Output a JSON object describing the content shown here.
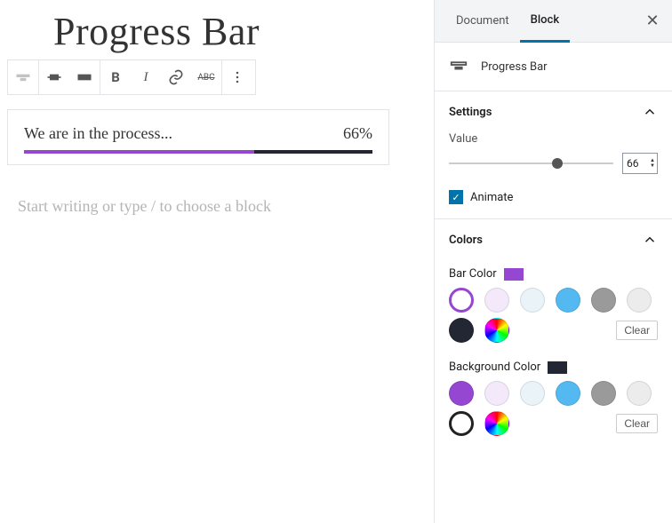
{
  "editor": {
    "page_title": "Progress Bar",
    "progress_label": "We are in the process...",
    "progress_value_text": "66%",
    "progress_percent": 66,
    "placeholder": "Start writing or type / to choose a block"
  },
  "sidebar": {
    "tabs": {
      "document": "Document",
      "block": "Block"
    },
    "block_name": "Progress Bar",
    "panels": {
      "settings": {
        "title": "Settings",
        "value_label": "Value",
        "value": "66",
        "animate_label": "Animate",
        "animate_checked": true
      },
      "colors": {
        "title": "Colors",
        "bar_color_label": "Bar Color",
        "bar_color": "#9547d1",
        "bg_color_label": "Background Color",
        "bg_color": "#222733",
        "clear_label": "Clear",
        "palette": [
          "#f3e9fb",
          "#e9f3f8",
          "#54b9f0",
          "#9a9a9a",
          "#ececec",
          "#222733"
        ],
        "palette2": [
          "#9547d1",
          "#f3e9fb",
          "#e9f3f8",
          "#54b9f0",
          "#9a9a9a",
          "#ececec"
        ]
      }
    }
  }
}
